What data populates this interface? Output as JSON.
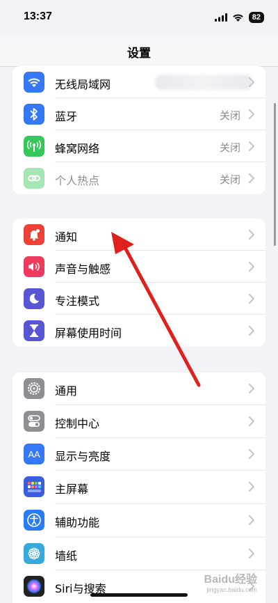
{
  "status": {
    "time": "13:37",
    "battery": "82"
  },
  "nav": {
    "title": "设置"
  },
  "group1": [
    {
      "icon": "wifi-icon",
      "label": "无线局域网",
      "value": "",
      "color": "#3478f6"
    },
    {
      "icon": "bluetooth-icon",
      "label": "蓝牙",
      "value": "关闭",
      "color": "#3478f6"
    },
    {
      "icon": "cellular-icon",
      "label": "蜂窝网络",
      "value": "关闭",
      "color": "#35c759"
    },
    {
      "icon": "hotspot-icon",
      "label": "个人热点",
      "value": "关闭",
      "color": "#35c759"
    }
  ],
  "group2": [
    {
      "icon": "notifications-icon",
      "label": "通知",
      "color": "#ee4137"
    },
    {
      "icon": "sounds-icon",
      "label": "声音与触感",
      "color": "#ee3a5c"
    },
    {
      "icon": "focus-moon-icon",
      "label": "专注模式",
      "color": "#5956d6"
    },
    {
      "icon": "screen-time-icon",
      "label": "屏幕使用时间",
      "color": "#5956d6"
    }
  ],
  "group3": [
    {
      "icon": "gear-icon",
      "label": "通用",
      "color": "#8e8e93"
    },
    {
      "icon": "control-center-icon",
      "label": "控制中心",
      "color": "#8e8e93"
    },
    {
      "icon": "display-brightness-icon",
      "label": "显示与亮度",
      "color": "#3478f6"
    },
    {
      "icon": "home-screen-icon",
      "label": "主屏幕",
      "color": "#3a5ee0"
    },
    {
      "icon": "accessibility-icon",
      "label": "辅助功能",
      "color": "#2a7cf6"
    },
    {
      "icon": "wallpaper-icon",
      "label": "墙纸",
      "color": "#36aadc"
    },
    {
      "icon": "siri-icon",
      "label": "Siri与搜索",
      "color": "#222222"
    }
  ],
  "annotation": {
    "color": "#e0201c"
  },
  "watermark": {
    "text": "Baidu经验",
    "sub": "jingyan.baidu.com"
  }
}
